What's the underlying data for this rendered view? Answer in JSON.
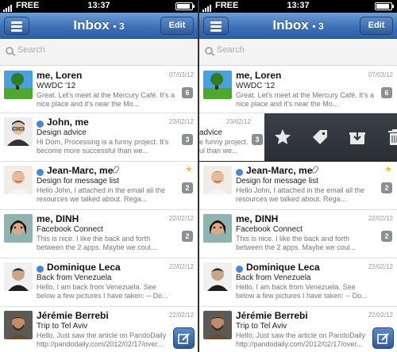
{
  "status_bar": {
    "carrier": "FREE",
    "time": "13:37"
  },
  "nav": {
    "title": "Inbox",
    "count": "• 3",
    "edit_label": "Edit"
  },
  "search": {
    "placeholder": "Search"
  },
  "messages": [
    {
      "from": "me, Loren",
      "date": "07/03/12",
      "subject": "WWDC '12",
      "preview": "Great. Let's meet at the Mercury Café. It's a nice place and it's near the Mo...",
      "count": "6",
      "unread": false,
      "starred": false,
      "attachment": false,
      "avatar": "grass-tree-photo"
    },
    {
      "from": "John, me",
      "date": "23/02/12",
      "subject": "Design advice",
      "preview": "Hi Dom, Processing is a funny project. It's become more successful than we...",
      "count": "3",
      "unread": true,
      "starred": false,
      "attachment": false,
      "avatar": "man-with-glasses-photo"
    },
    {
      "from": "Jean-Marc, me",
      "date": "",
      "subject": "Design for message list",
      "preview": "Hello John, I attached in the email all the resources we talked about. Rega...",
      "count": "2",
      "unread": true,
      "starred": true,
      "attachment": true,
      "avatar": "smiling-man-photo"
    },
    {
      "from": "me, DINH",
      "date": "22/02/12",
      "subject": "Facebook Connect",
      "preview": "This is nice. I like the back and forth between the 2 apps. Maybe we coul...",
      "count": "2",
      "unread": false,
      "starred": false,
      "attachment": false,
      "avatar": "woman-photo"
    },
    {
      "from": "Dominique Leca",
      "date": "22/02/12",
      "subject": "Back from Venezuela",
      "preview": "Hello, I am back from Venezuela. See below a few pictures I have taken: -- Do...",
      "count": "",
      "unread": true,
      "starred": false,
      "attachment": false,
      "avatar": "man-photo"
    },
    {
      "from": "Jérémie Berrebi",
      "date": "22/02/12",
      "subject": "Trip to Tel Aviv",
      "preview": "Hello, Just saw the article on PandoDaily http://pandodaily.com/2012/02/17/over...",
      "count": "",
      "unread": false,
      "starred": false,
      "attachment": false,
      "avatar": "bearded-man-photo"
    }
  ],
  "swipe": {
    "date": "23/02/12",
    "subject_fragment": "advice",
    "preview_fragment_1": "e funny project.",
    "preview_fragment_2": "ul than we...",
    "count": "3",
    "actions": [
      "star-icon",
      "tag-icon",
      "archive-icon",
      "trash-icon"
    ]
  },
  "colors": {
    "nav_blue": "#3d70b8",
    "unread_dot": "#4a86d8",
    "star": "#f2c12e",
    "badge": "#8a8f96"
  }
}
